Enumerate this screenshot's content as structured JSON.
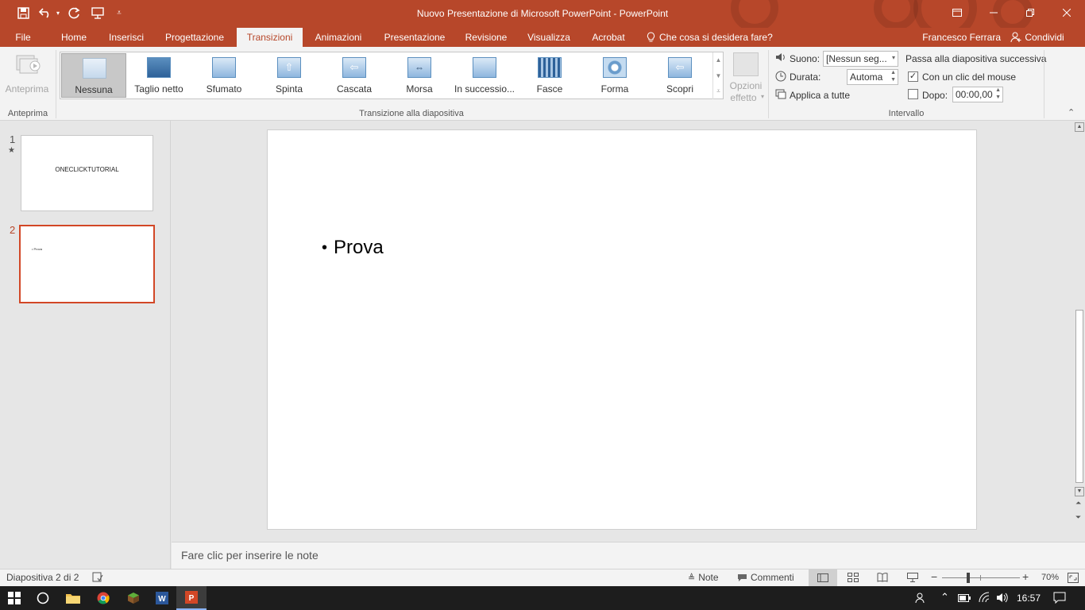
{
  "window": {
    "title": "Nuovo Presentazione di Microsoft PowerPoint - PowerPoint",
    "accent": "#b7472a",
    "quick_access": [
      "save-icon",
      "undo-icon",
      "redo-icon",
      "start-from-beginning-icon",
      "customize-icon"
    ]
  },
  "tabs": [
    "File",
    "Home",
    "Inserisci",
    "Progettazione",
    "Transizioni",
    "Animazioni",
    "Presentazione",
    "Revisione",
    "Visualizza",
    "Acrobat"
  ],
  "active_tab": "Transizioni",
  "tell_me": "Che cosa si desidera fare?",
  "user": "Francesco Ferrara",
  "share": "Condividi",
  "ribbon": {
    "preview": {
      "button": "Anteprima",
      "group": "Anteprima"
    },
    "transitions": {
      "group": "Transizione alla diapositiva",
      "items": [
        "Nessuna",
        "Taglio netto",
        "Sfumato",
        "Spinta",
        "Cascata",
        "Morsa",
        "In successio...",
        "Fasce",
        "Forma",
        "Scopri"
      ],
      "selected": "Nessuna",
      "effect_options_1": "Opzioni",
      "effect_options_2": "effetto"
    },
    "timing": {
      "group": "Intervallo",
      "sound_label": "Suono:",
      "sound_value": "[Nessun seg...",
      "duration_label": "Durata:",
      "duration_value": "Automa",
      "apply_all": "Applica a tutte",
      "advance_title": "Passa alla diapositiva successiva",
      "on_click_label": "Con un clic del mouse",
      "on_click_checked": true,
      "after_label": "Dopo:",
      "after_checked": false,
      "after_value": "00:00,00"
    }
  },
  "slides": [
    {
      "number": "1",
      "star": "★",
      "title": "ONECLICKTUTORIAL"
    },
    {
      "number": "2",
      "bullet": "• Prova"
    }
  ],
  "current_slide": {
    "bullet": "•",
    "text": "Prova"
  },
  "notes_placeholder": "Fare clic per inserire le note",
  "status": {
    "slide_info": "Diapositiva 2 di 2",
    "notes": "Note",
    "comments": "Commenti",
    "zoom": "70%",
    "zoom_value": 0.7
  },
  "taskbar": {
    "time": "16:57",
    "apps": [
      "windows-start-icon",
      "cortana-icon",
      "file-explorer-icon",
      "chrome-icon",
      "minecraft-icon",
      "word-icon",
      "powerpoint-icon"
    ]
  }
}
